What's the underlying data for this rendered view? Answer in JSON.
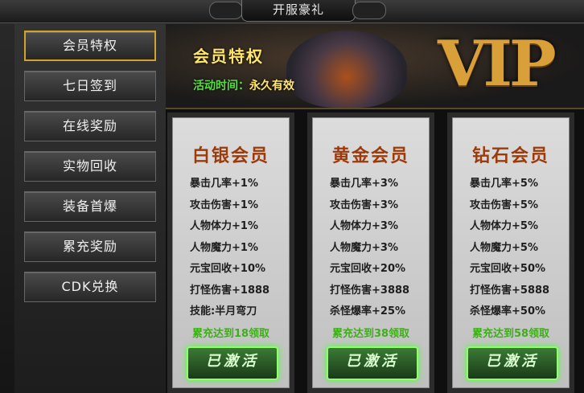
{
  "window": {
    "title": "开服豪礼"
  },
  "sidebar": {
    "items": [
      {
        "label": "会员特权",
        "active": true
      },
      {
        "label": "七日签到",
        "active": false
      },
      {
        "label": "在线奖励",
        "active": false
      },
      {
        "label": "实物回收",
        "active": false
      },
      {
        "label": "装备首爆",
        "active": false
      },
      {
        "label": "累充奖励",
        "active": false
      },
      {
        "label": "CDK兑换",
        "active": false
      }
    ]
  },
  "banner": {
    "title": "会员特权",
    "time_label": "活动时间：",
    "time_value": "永久有效",
    "logo_text": "VIP"
  },
  "cards": [
    {
      "title": "白银会员",
      "perks": [
        "暴击几率+1%",
        "攻击伤害+1%",
        "人物体力+1%",
        "人物魔力+1%",
        "元宝回收+10%",
        "打怪伤害+1888",
        "技能:半月弯刀"
      ],
      "requirement": "累充达到18领取",
      "button": "已激活"
    },
    {
      "title": "黄金会员",
      "perks": [
        "暴击几率+3%",
        "攻击伤害+3%",
        "人物体力+3%",
        "人物魔力+3%",
        "元宝回收+20%",
        "打怪伤害+3888",
        "杀怪爆率+25%"
      ],
      "requirement": "累充达到38领取",
      "button": "已激活"
    },
    {
      "title": "钻石会员",
      "perks": [
        "暴击几率+5%",
        "攻击伤害+5%",
        "人物体力+5%",
        "人物魔力+5%",
        "元宝回收+50%",
        "打怪伤害+5888",
        "杀怪爆率+50%"
      ],
      "requirement": "累充达到58领取",
      "button": "已激活"
    }
  ],
  "colors": {
    "accent_gold": "#d4a22a",
    "title_red": "#9c3a0a",
    "active_green": "#4bff35"
  }
}
